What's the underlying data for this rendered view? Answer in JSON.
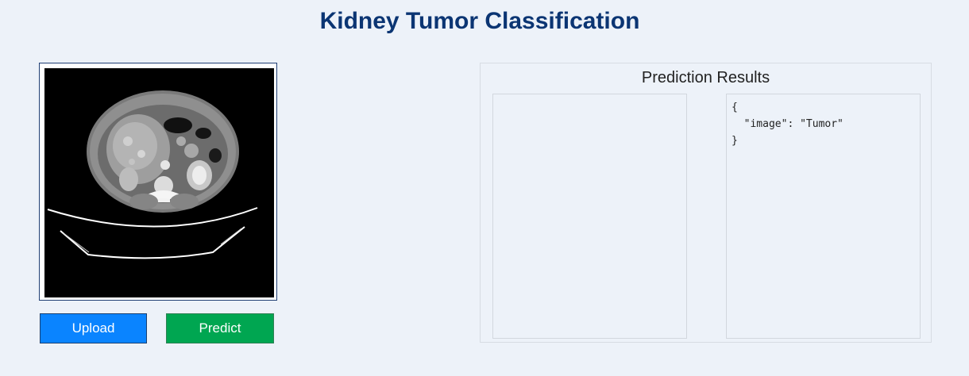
{
  "header": {
    "title": "Kidney Tumor Classification"
  },
  "image_panel": {
    "image_description": "abdomen-ct-scan"
  },
  "buttons": {
    "upload_label": "Upload",
    "predict_label": "Predict"
  },
  "results": {
    "title": "Prediction Results",
    "json_lines": [
      "{",
      "  \"image\": \"Tumor\"",
      "}"
    ]
  },
  "colors": {
    "title": "#0b3573",
    "upload": "#0a84ff",
    "predict": "#00a651",
    "background": "#edf2f9"
  }
}
